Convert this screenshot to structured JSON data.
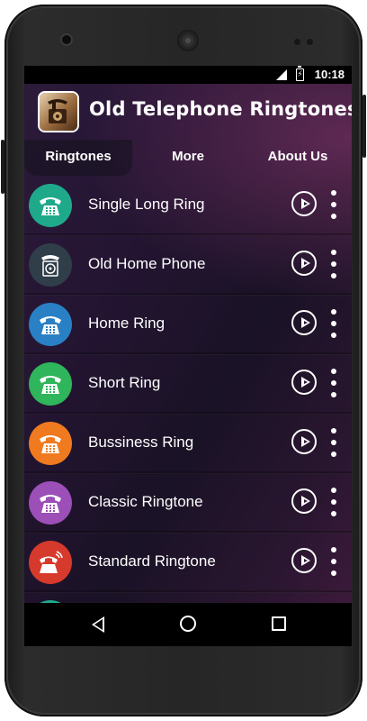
{
  "status_bar": {
    "time": "10:18"
  },
  "app": {
    "title": "Old Telephone Ringtones",
    "icon": "vintage-telephone-icon"
  },
  "tabs": [
    {
      "label": "Ringtones",
      "active": true
    },
    {
      "label": "More",
      "active": false
    },
    {
      "label": "About Us",
      "active": false
    }
  ],
  "ringtones": [
    {
      "label": "Single Long Ring",
      "icon": "telephone-icon",
      "color": "#1fa98b"
    },
    {
      "label": "Old Home Phone",
      "icon": "rotary-phone-icon",
      "color": "#2f3e48"
    },
    {
      "label": "Home Ring",
      "icon": "telephone-icon",
      "color": "#2a80c4"
    },
    {
      "label": "Short Ring",
      "icon": "telephone-icon",
      "color": "#2fb55b"
    },
    {
      "label": "Bussiness Ring",
      "icon": "telephone-icon",
      "color": "#f07a1f"
    },
    {
      "label": "Classic Ringtone",
      "icon": "telephone-icon",
      "color": "#9b4fb7"
    },
    {
      "label": "Standard Ringtone",
      "icon": "ringing-phone-icon",
      "color": "#d63a2c"
    },
    {
      "label": "",
      "icon": "telephone-icon",
      "color": "#1fa98b"
    }
  ],
  "nav": {
    "back": "back-icon",
    "home": "home-icon",
    "recent": "recent-apps-icon"
  }
}
